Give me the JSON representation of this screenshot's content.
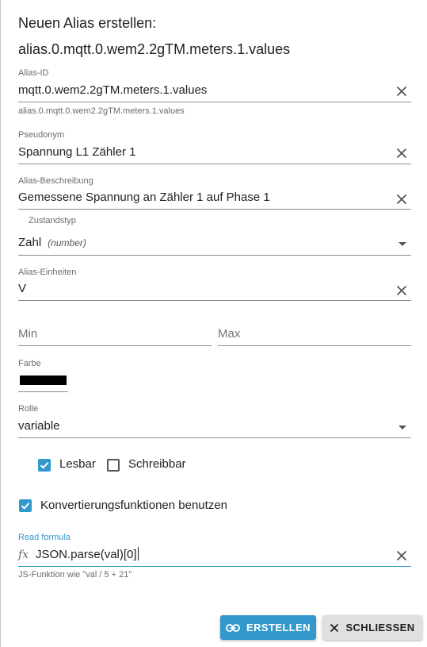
{
  "dialog": {
    "title_line1": "Neuen Alias erstellen:",
    "title_line2": "alias.0.mqtt.0.wem2.2gTM.meters.1.values"
  },
  "fields": {
    "alias_id": {
      "label": "Alias-ID",
      "value": "mqtt.0.wem2.2gTM.meters.1.values",
      "helper": "alias.0.mqtt.0.wem2.2gTM.meters.1.values"
    },
    "pseudonym": {
      "label": "Pseudonym",
      "value": "Spannung L1 Zähler 1"
    },
    "description": {
      "label": "Alias-Beschreibung",
      "value": "Gemessene Spannung an Zähler 1 auf Phase 1"
    },
    "state_type": {
      "label": "Zustandstyp",
      "value": "Zahl",
      "hint": "(number)"
    },
    "units": {
      "label": "Alias-Einheiten",
      "value": "V"
    },
    "min": {
      "placeholder": "Min"
    },
    "max": {
      "placeholder": "Max"
    },
    "color": {
      "label": "Farbe",
      "value": "#000000"
    },
    "role": {
      "label": "Rolle",
      "value": "variable"
    },
    "read_formula": {
      "label": "Read formula",
      "value": "JSON.parse(val)[0]",
      "helper": "JS-Funktion wie \"val / 5 + 21\""
    }
  },
  "checkboxes": {
    "readable": {
      "label": "Lesbar",
      "checked": true
    },
    "writable": {
      "label": "Schreibbar",
      "checked": false
    },
    "use_conversion": {
      "label": "Konvertierungsfunktionen benutzen",
      "checked": true
    }
  },
  "buttons": {
    "create_label": "ERSTELLEN",
    "close_label": "SCHLIESSEN"
  },
  "colors": {
    "accent": "#3399cc",
    "underline": "#8c8c8c",
    "secondary_button": "#e0e0e0"
  },
  "icons": {
    "clear": "close-icon",
    "fx": "function-icon",
    "create": "link-icon",
    "close": "close-icon"
  }
}
